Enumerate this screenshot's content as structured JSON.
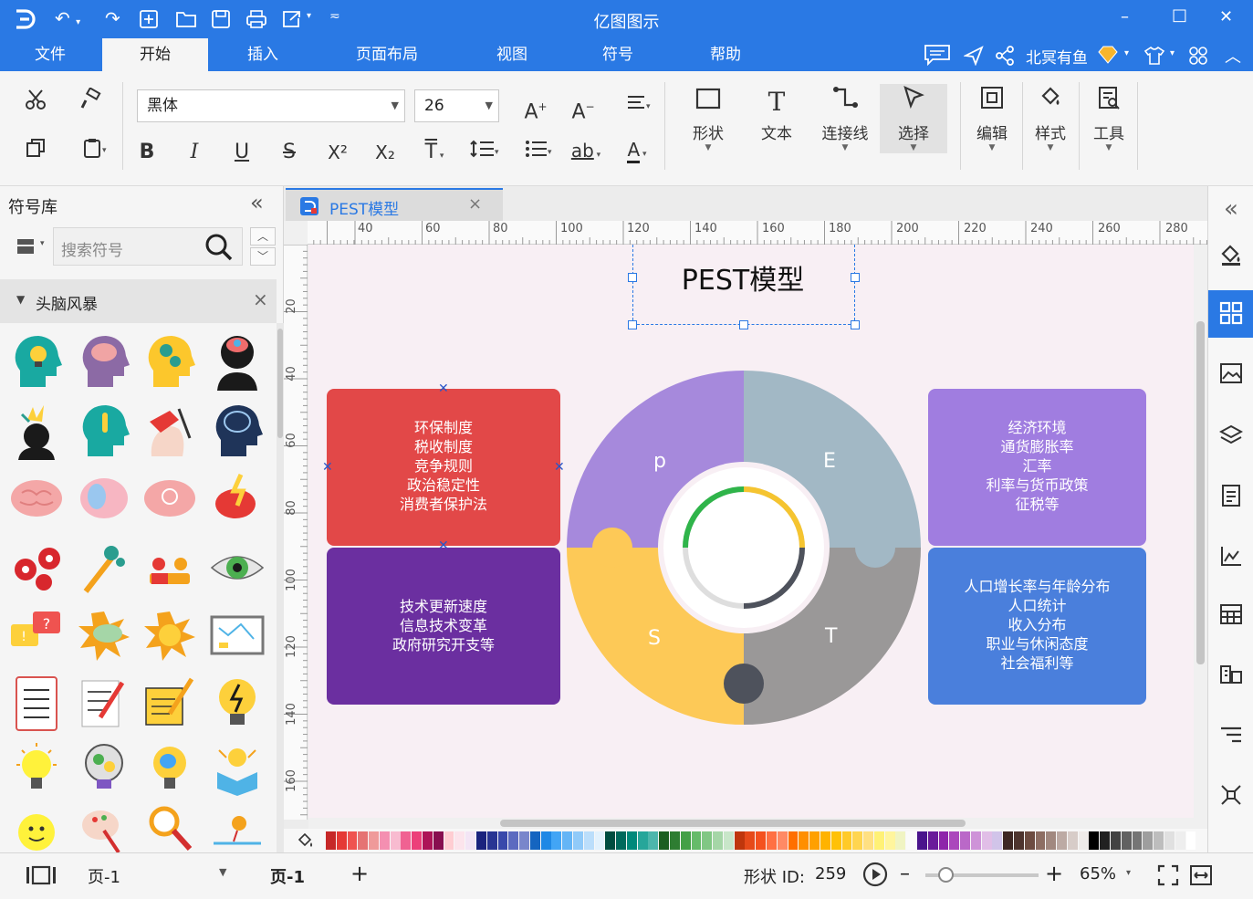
{
  "window": {
    "title": "亿图图示"
  },
  "quick_access": [
    "logo-icon",
    "undo-icon",
    "redo-icon",
    "new-icon",
    "open-icon",
    "save-icon",
    "print-icon",
    "export-icon",
    "customize-icon"
  ],
  "window_controls": {
    "minimize": "–",
    "maximize": "□",
    "close": "✕"
  },
  "menu": {
    "items": [
      "文件",
      "开始",
      "插入",
      "页面布局",
      "视图",
      "符号",
      "帮助"
    ],
    "active": "开始",
    "user": "北冥有鱼"
  },
  "ribbon": {
    "font_name": "黑体",
    "font_size": "26",
    "shape_label": "形状",
    "text_label": "文本",
    "connector_label": "连接线",
    "select_label": "选择",
    "edit_label": "编辑",
    "style_label": "样式",
    "tools_label": "工具",
    "format_glyphs": {
      "bold": "B",
      "italic": "I",
      "underline": "U",
      "strike": "S",
      "sup": "X²",
      "sub": "X₂",
      "text_t": "T",
      "ab": "ab",
      "font_a": "A"
    }
  },
  "library": {
    "title": "符号库",
    "collapse": "«",
    "search_placeholder": "搜索符号",
    "category": "头脑风暴",
    "category_close": "×"
  },
  "document": {
    "tab_title": "PEST模型",
    "tab_close": "×",
    "ruler_top": [
      "40",
      "60",
      "80",
      "100",
      "120",
      "140",
      "160",
      "180",
      "200",
      "220",
      "240",
      "260",
      "280"
    ],
    "ruler_left": [
      "20",
      "40",
      "60",
      "80",
      "100",
      "120",
      "140",
      "160"
    ],
    "diagram_title": "PEST模型",
    "boxes": {
      "political": [
        "环保制度",
        "税收制度",
        "竞争规则",
        "政治稳定性",
        "消费者保护法"
      ],
      "economic": [
        "经济环境",
        "通货膨胀率",
        "汇率",
        "利率与货币政策",
        "征税等"
      ],
      "technological": [
        "技术更新速度",
        "信息技术变革",
        "政府研究开支等"
      ],
      "social": [
        "人口增长率与年龄分布",
        "人口统计",
        "收入分布",
        "职业与休闲态度",
        "社会福利等"
      ]
    },
    "wheel_letters": {
      "p": "p",
      "e": "E",
      "s": "S",
      "t": "T"
    }
  },
  "status": {
    "page_select": "页-1",
    "page_tab": "页-1",
    "add_page": "+",
    "shape_id_label": "形状 ID:",
    "shape_id": "259",
    "zoom": "65%",
    "zoom_minus": "–",
    "zoom_plus": "+"
  },
  "colors": {
    "accent": "#2a79e4",
    "political": "#e24848",
    "economic": "#a07de0",
    "technological": "#6b2fa0",
    "social": "#4a7fdc",
    "wheel_p": "#a689dc",
    "wheel_e": "#a2b8c5",
    "wheel_s": "#fdc957",
    "wheel_t": "#9a9898",
    "canvas_bg": "#f8eff4"
  }
}
